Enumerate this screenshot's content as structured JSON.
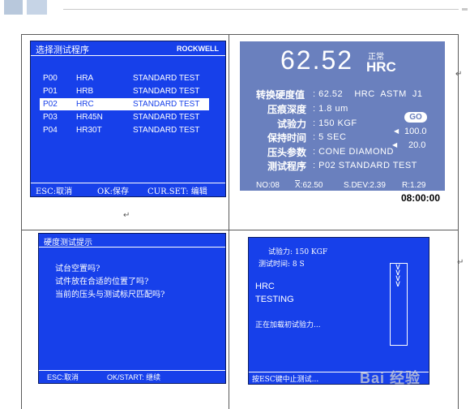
{
  "screen1": {
    "title": "选择测试程序",
    "mode": "ROCKWELL",
    "rows": [
      {
        "code": "P00",
        "scale": "HRA",
        "type": "STANDARD TEST"
      },
      {
        "code": "P01",
        "scale": "HRB",
        "type": "STANDARD TEST"
      },
      {
        "code": "P02",
        "scale": "HRC",
        "type": "STANDARD TEST"
      },
      {
        "code": "P03",
        "scale": "HR45N",
        "type": "STANDARD TEST"
      },
      {
        "code": "P04",
        "scale": "HR30T",
        "type": "STANDARD TEST"
      }
    ],
    "footer": {
      "esc": "ESC:取消",
      "ok": "OK:保存",
      "cur": "CUR.SET: 编辑"
    }
  },
  "screen2": {
    "hardness": "62.52",
    "status": "正常",
    "scale": "HRC",
    "rows": [
      {
        "label": "转换硬度值",
        "value": ": 62.52    HRC  ASTM  J1"
      },
      {
        "label": "压痕深度",
        "value": ": 1.8 um"
      },
      {
        "label": "试验力",
        "value": ": 150 KGF"
      },
      {
        "label": "保持时间",
        "value": ": 5 SEC"
      },
      {
        "label": "压头参数",
        "value": ": CONE DIAMOND"
      },
      {
        "label": "测试程序",
        "value": ": P02 STANDARD TEST"
      }
    ],
    "go": "GO",
    "upper_limit": "100.0",
    "lower_limit": "20.0",
    "stats": {
      "n": "NO:08",
      "mean": "X:62.50",
      "sdev": "S.DEV:2.39",
      "range": "R:1.29"
    },
    "time": "08:00:00"
  },
  "screen3": {
    "title": "硬度测试提示",
    "lines": [
      "试台空置吗?",
      "试件放在合适的位置了吗?",
      "当前的压头与测试标尺匹配吗?"
    ],
    "footer": {
      "esc": "ESC:取消",
      "ok": "OK/START: 继续"
    }
  },
  "screen4": {
    "force": "试验力: 150 KGF",
    "time": "测试时间: 8 S",
    "scale": "HRC",
    "status": "TESTING",
    "message": "正在加载初试验力...",
    "footer": "按ESC键中止测试...",
    "watermark": "Bai 经验"
  },
  "marks": {
    "return": "↵"
  }
}
